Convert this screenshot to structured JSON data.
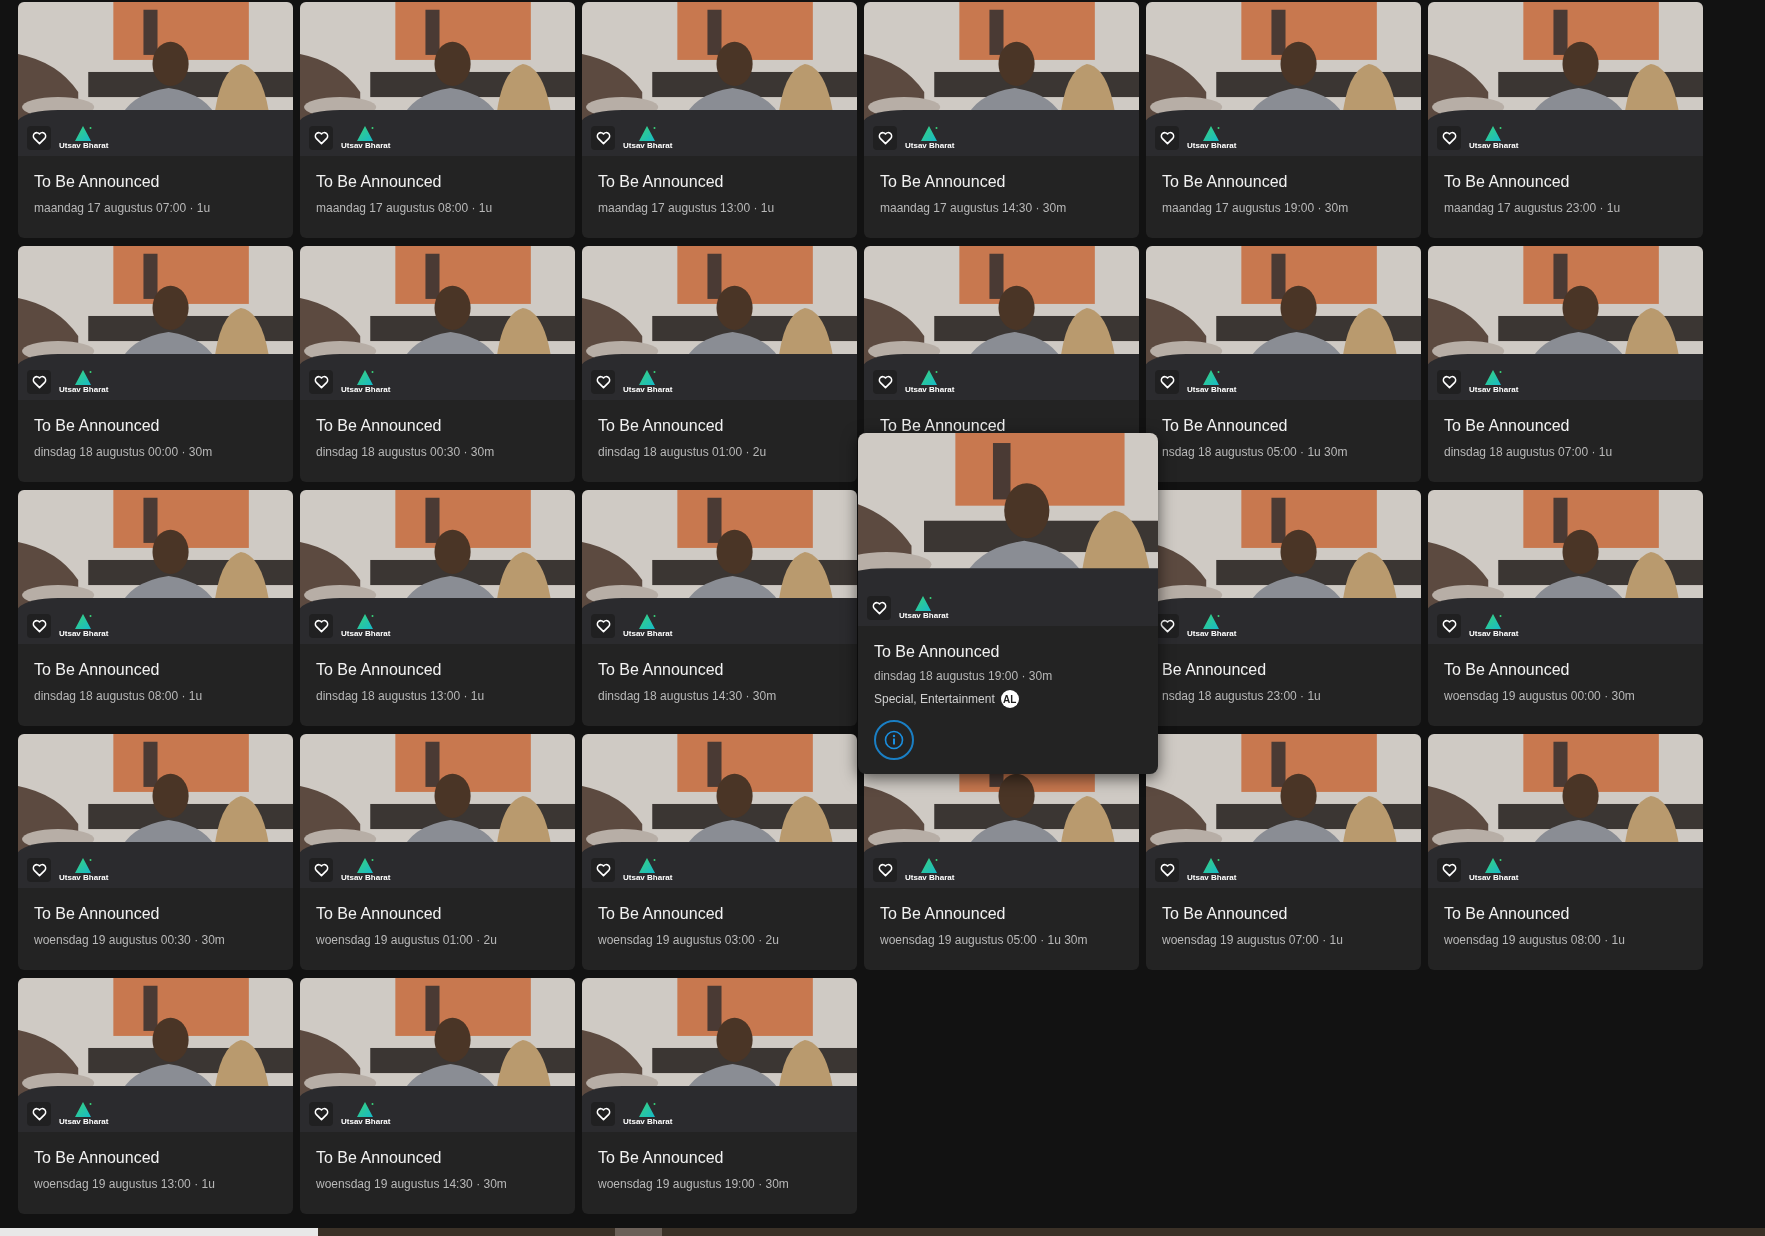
{
  "rows": [
    {
      "items": [
        {
          "kind": "card",
          "title": "To Be Announced",
          "subtitle": "maandag 17 augustus 07:00 · 1u",
          "channel": "Utsav Bharat"
        },
        {
          "kind": "card",
          "title": "To Be Announced",
          "subtitle": "maandag 17 augustus 08:00 · 1u",
          "channel": "Utsav Bharat"
        },
        {
          "kind": "card",
          "title": "To Be Announced",
          "subtitle": "maandag 17 augustus 13:00 · 1u",
          "channel": "Utsav Bharat"
        },
        {
          "kind": "card",
          "title": "To Be Announced",
          "subtitle": "maandag 17 augustus 14:30 · 30m",
          "channel": "Utsav Bharat"
        },
        {
          "kind": "card",
          "title": "To Be Announced",
          "subtitle": "maandag 17 augustus 19:00 · 30m",
          "channel": "Utsav Bharat"
        },
        {
          "kind": "card",
          "title": "To Be Announced",
          "subtitle": "maandag 17 augustus 23:00 · 1u",
          "channel": "Utsav Bharat"
        }
      ]
    },
    {
      "items": [
        {
          "kind": "card",
          "title": "To Be Announced",
          "subtitle": "dinsdag 18 augustus 00:00 · 30m",
          "channel": "Utsav Bharat"
        },
        {
          "kind": "card",
          "title": "To Be Announced",
          "subtitle": "dinsdag 18 augustus 00:30 · 30m",
          "channel": "Utsav Bharat"
        },
        {
          "kind": "card",
          "title": "To Be Announced",
          "subtitle": "dinsdag 18 augustus 01:00 · 2u",
          "channel": "Utsav Bharat"
        },
        {
          "kind": "card",
          "title": "To Be Announced",
          "channel": "Utsav Bharat"
        },
        {
          "kind": "card",
          "title": "To Be Announced",
          "subtitle": "nsdag 18 augustus 05:00 · 1u 30m",
          "channel": "Utsav Bharat"
        },
        {
          "kind": "card",
          "title": "To Be Announced",
          "subtitle": "dinsdag 18 augustus 07:00 · 1u",
          "channel": "Utsav Bharat"
        }
      ]
    },
    {
      "items": [
        {
          "kind": "card",
          "title": "To Be Announced",
          "subtitle": "dinsdag 18 augustus 08:00 · 1u",
          "channel": "Utsav Bharat"
        },
        {
          "kind": "card",
          "title": "To Be Announced",
          "subtitle": "dinsdag 18 augustus 13:00 · 1u",
          "channel": "Utsav Bharat"
        },
        {
          "kind": "card",
          "title": "To Be Announced",
          "subtitle": "dinsdag 18 augustus 14:30 · 30m",
          "channel": "Utsav Bharat"
        },
        {
          "kind": "popup",
          "title": "To Be Announced",
          "subtitle": "dinsdag 18 augustus 19:00 · 30m",
          "genres": "Special, Entertainment",
          "badge": "AL",
          "channel": "Utsav Bharat"
        },
        {
          "kind": "card",
          "title": "Be Announced",
          "subtitle": "nsdag 18 augustus 23:00 · 1u",
          "channel": "Utsav Bharat"
        },
        {
          "kind": "card",
          "title": "To Be Announced",
          "subtitle": "woensdag 19 augustus 00:00 · 30m",
          "channel": "Utsav Bharat"
        }
      ]
    },
    {
      "items": [
        {
          "kind": "card",
          "title": "To Be Announced",
          "subtitle": "woensdag 19 augustus 00:30 · 30m",
          "channel": "Utsav Bharat"
        },
        {
          "kind": "card",
          "title": "To Be Announced",
          "subtitle": "woensdag 19 augustus 01:00 · 2u",
          "channel": "Utsav Bharat"
        },
        {
          "kind": "card",
          "title": "To Be Announced",
          "subtitle": "woensdag 19 augustus 03:00 · 2u",
          "channel": "Utsav Bharat"
        },
        {
          "kind": "card",
          "title": "To Be Announced",
          "subtitle": "woensdag 19 augustus 05:00 · 1u 30m",
          "channel": "Utsav Bharat"
        },
        {
          "kind": "card",
          "title": "To Be Announced",
          "subtitle": "woensdag 19 augustus 07:00 · 1u",
          "channel": "Utsav Bharat"
        },
        {
          "kind": "card",
          "title": "To Be Announced",
          "subtitle": "woensdag 19 augustus 08:00 · 1u",
          "channel": "Utsav Bharat"
        }
      ]
    },
    {
      "items": [
        {
          "kind": "card",
          "title": "To Be Announced",
          "subtitle": "woensdag 19 augustus 13:00 · 1u",
          "channel": "Utsav Bharat"
        },
        {
          "kind": "card",
          "title": "To Be Announced",
          "subtitle": "woensdag 19 augustus 14:30 · 30m",
          "channel": "Utsav Bharat"
        },
        {
          "kind": "card",
          "title": "To Be Announced",
          "subtitle": "woensdag 19 augustus 19:00 · 30m",
          "channel": "Utsav Bharat"
        }
      ]
    }
  ]
}
